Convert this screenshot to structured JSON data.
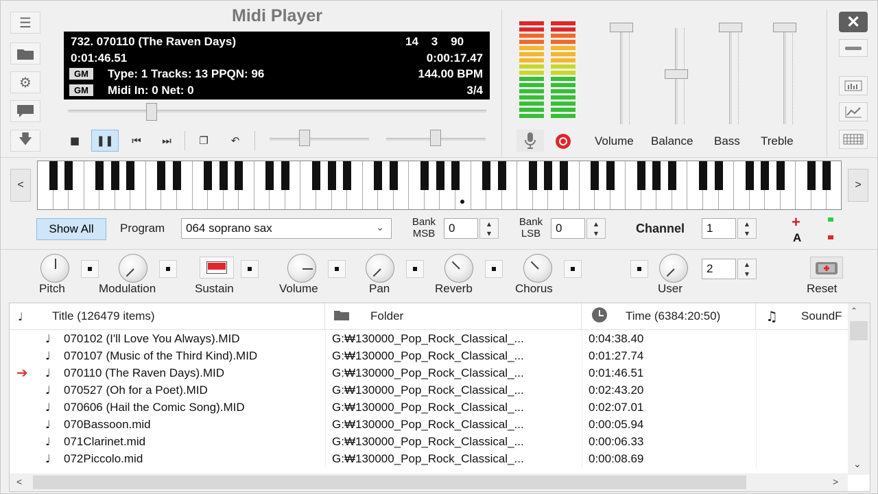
{
  "app": {
    "title": "Midi Player"
  },
  "display": {
    "song": "732. 070110 (The Raven Days)",
    "counters": "14    3    90",
    "elapsed": "0:01:46.51",
    "remaining": "0:00:17.47",
    "gm1": "GM",
    "info1": "Type: 1  Tracks: 13  PPQN: 96",
    "bpm": "144.00 BPM",
    "gm2": "GM",
    "info2": "Midi In: 0  Net: 0",
    "timesig": "3/4"
  },
  "position": {
    "progress": 0.2
  },
  "mixer": {
    "labels": [
      "Volume",
      "Balance",
      "Bass",
      "Treble"
    ]
  },
  "program": {
    "show_all": "Show All",
    "label": "Program",
    "value": "064 soprano sax",
    "bank_msb_label1": "Bank",
    "bank_msb_label2": "MSB",
    "bank_msb_value": "0",
    "bank_lsb_label1": "Bank",
    "bank_lsb_label2": "LSB",
    "bank_lsb_value": "0",
    "channel_label": "Channel",
    "channel_value": "1",
    "a_label": "A"
  },
  "controllers": {
    "pitch": "Pitch",
    "modulation": "Modulation",
    "sustain": "Sustain",
    "volume": "Volume",
    "pan": "Pan",
    "reverb": "Reverb",
    "chorus": "Chorus",
    "user": "User",
    "user_value": "2",
    "reset": "Reset"
  },
  "table": {
    "col_title": "Title (126479 items)",
    "col_folder": "Folder",
    "col_time": "Time (6384:20:50)",
    "col_soundfont": "SoundF",
    "rows": [
      {
        "title": "070102 (I'll Love You Always).MID",
        "folder": "G:₩130000_Pop_Rock_Classical_...",
        "time": "0:04:38.40"
      },
      {
        "title": "070107 (Music of the Third Kind).MID",
        "folder": "G:₩130000_Pop_Rock_Classical_...",
        "time": "0:01:27.74"
      },
      {
        "title": "070110 (The Raven Days).MID",
        "folder": "G:₩130000_Pop_Rock_Classical_...",
        "time": "0:01:46.51"
      },
      {
        "title": "070527 (Oh for a Poet).MID",
        "folder": "G:₩130000_Pop_Rock_Classical_...",
        "time": "0:02:43.20"
      },
      {
        "title": "070606 (Hail the Comic Song).MID",
        "folder": "G:₩130000_Pop_Rock_Classical_...",
        "time": "0:02:07.01"
      },
      {
        "title": "070Bassoon.mid",
        "folder": "G:₩130000_Pop_Rock_Classical_...",
        "time": "0:00:05.94"
      },
      {
        "title": "071Clarinet.mid",
        "folder": "G:₩130000_Pop_Rock_Classical_...",
        "time": "0:00:06.33"
      },
      {
        "title": "072Piccolo.mid",
        "folder": "G:₩130000_Pop_Rock_Classical_...",
        "time": "0:00:08.69"
      }
    ]
  },
  "colors": {
    "accent": "#cfe5f8",
    "record": "#e0262c",
    "playing_arrow": "#d83a3a"
  }
}
